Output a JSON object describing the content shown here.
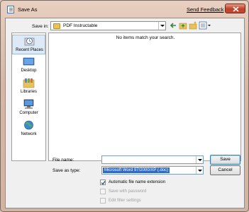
{
  "window": {
    "title": "Save As",
    "feedback_link": "Send Feedback"
  },
  "toolbar": {
    "save_in_label": "Save in:",
    "save_in_value": "PDF Instructable",
    "icons": [
      "back-icon",
      "up-folder-icon",
      "new-folder-icon",
      "views-menu-icon"
    ]
  },
  "places": [
    {
      "label": "Recent Places",
      "icon": "recent-places-icon",
      "selected": true
    },
    {
      "label": "Desktop",
      "icon": "desktop-icon",
      "selected": false
    },
    {
      "label": "Libraries",
      "icon": "libraries-icon",
      "selected": false
    },
    {
      "label": "Computer",
      "icon": "computer-icon",
      "selected": false
    },
    {
      "label": "Network",
      "icon": "network-icon",
      "selected": false
    }
  ],
  "file_list": {
    "empty_message": "No items match your search."
  },
  "form": {
    "file_name_label": "File name:",
    "file_name_value": "",
    "save_as_type_label": "Save as type:",
    "save_as_type_value": "Microsoft Word 97/2000/XP (.doc)",
    "save_button": "Save",
    "cancel_button": "Cancel"
  },
  "options": [
    {
      "label": "Automatic file name extension",
      "checked": true,
      "enabled": true
    },
    {
      "label": "Save with password",
      "checked": false,
      "enabled": false
    },
    {
      "label": "Edit filter settings",
      "checked": false,
      "enabled": false
    }
  ],
  "colors": {
    "close_button": "#c0402a",
    "selection": "#316ac5",
    "frame": "#d6b7a4"
  }
}
